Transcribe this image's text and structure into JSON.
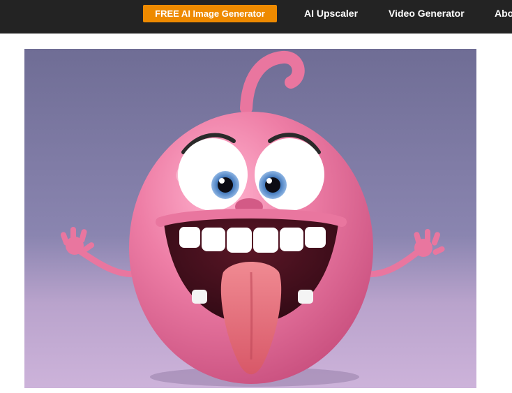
{
  "nav": {
    "cta_label": "FREE AI Image Generator",
    "links": [
      {
        "label": "AI Upscaler"
      },
      {
        "label": "Video Generator"
      },
      {
        "label": "Abo"
      }
    ]
  },
  "hero": {
    "subject": "pink cartoon emoji character with tongue out",
    "colors": {
      "background_top": "#7c7aa3",
      "background_bottom": "#c4a9d3",
      "body": "#e9769f",
      "tongue": "#e46c78",
      "eye_iris": "#4a7fc0"
    }
  },
  "colors": {
    "topbar": "#232323",
    "cta": "#ee8a00",
    "link": "#ffffff"
  }
}
